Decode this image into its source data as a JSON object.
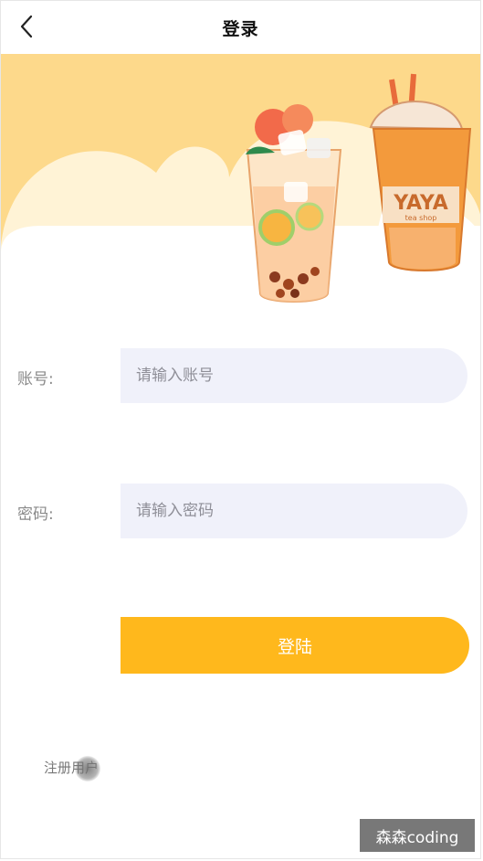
{
  "header": {
    "title": "登录"
  },
  "banner": {
    "cup_text": "YAYA",
    "cup_subtext": "tea shop",
    "colors": {
      "background": "#fdd98b",
      "cloud": "#fff3d6",
      "accent": "#f39a3c"
    }
  },
  "form": {
    "account": {
      "label": "账号:",
      "placeholder": "请输入账号"
    },
    "password": {
      "label": "密码:",
      "placeholder": "请输入密码"
    }
  },
  "actions": {
    "login_label": "登陆",
    "register_label": "注册用户"
  },
  "watermark": "森森coding",
  "colors": {
    "primary": "#ffb81c",
    "input_bg": "#f0f1fa",
    "label": "#8a8a8a"
  },
  "icons": {
    "back": "chevron-left-icon"
  }
}
